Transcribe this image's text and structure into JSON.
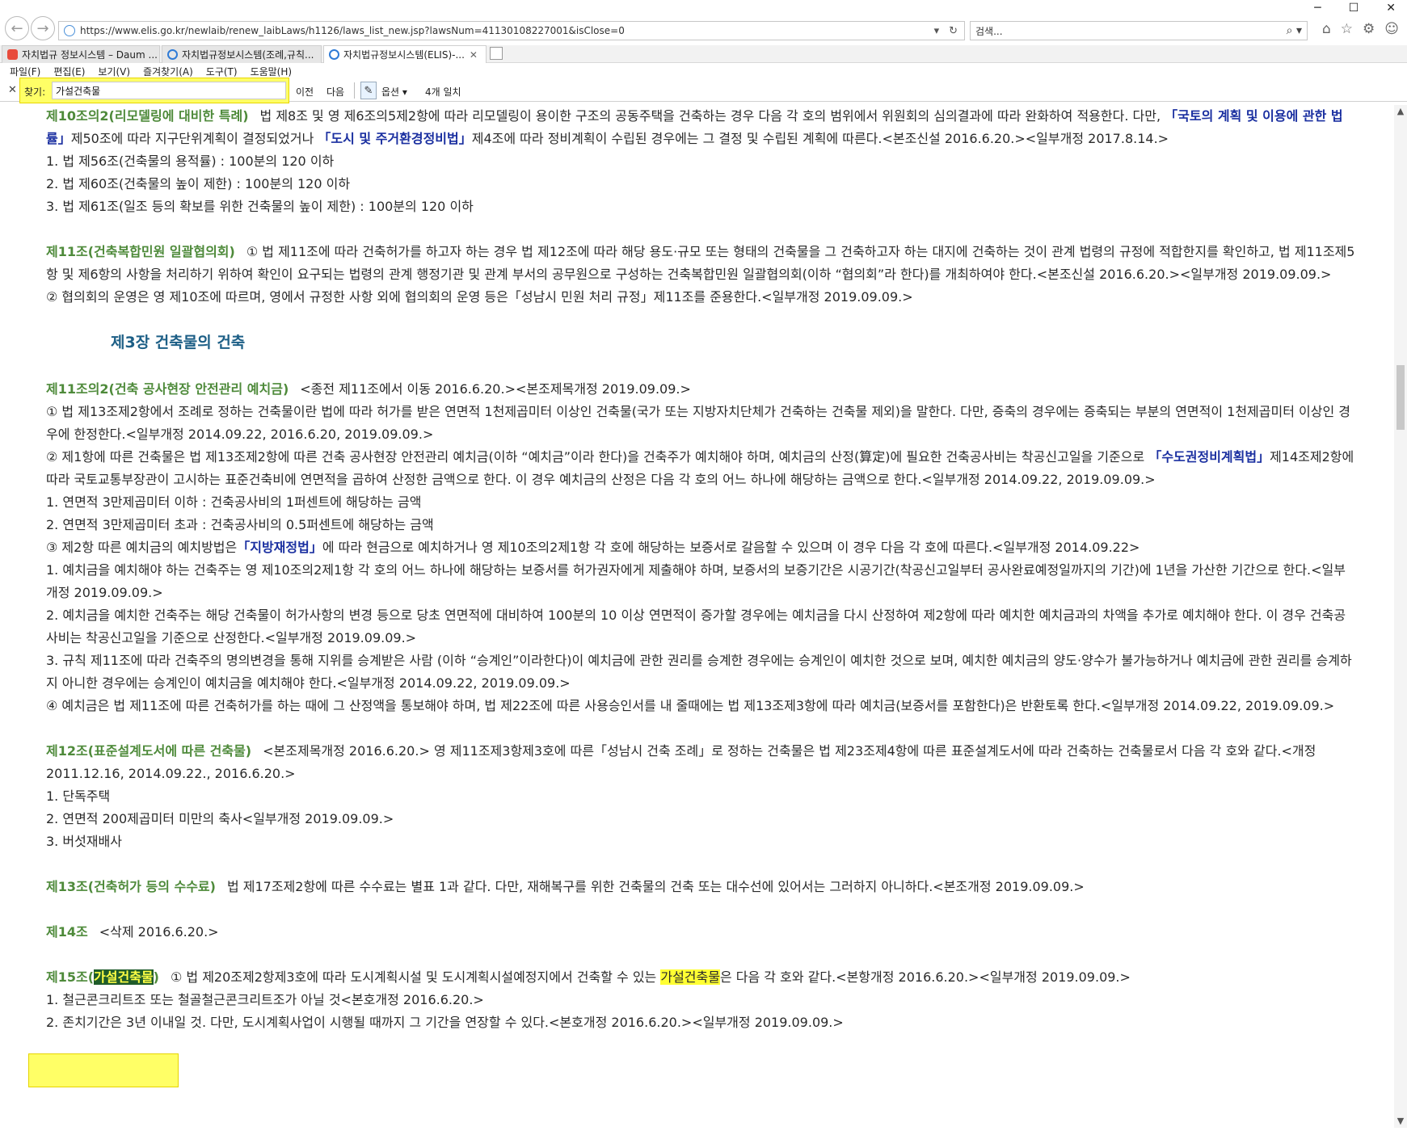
{
  "window": {
    "minimize": "─",
    "maximize": "☐",
    "close": "✕"
  },
  "address_bar": {
    "url": "https://www.elis.go.kr/newlaib/renew_laibLaws/h1126/laws_list_new.jsp?lawsNum=41130108227001&isClose=0"
  },
  "search": {
    "placeholder": "검색..."
  },
  "tabs": [
    {
      "label": "자치법규 정보시스템 – Daum ...",
      "icon_color": "#e84b3c"
    },
    {
      "label": "자치법규정보시스템(조례,규칙...",
      "icon_color": "#2f7bd6"
    },
    {
      "label": "자치법규정보시스템(ELIS)-...",
      "icon_color": "#2f7bd6"
    }
  ],
  "menu": [
    "파일(F)",
    "편집(E)",
    "보기(V)",
    "즐겨찾기(A)",
    "도구(T)",
    "도움말(H)"
  ],
  "find": {
    "label": "찾기:",
    "value": "가설건축물",
    "prev": "이전",
    "next": "다음",
    "options": "옵션",
    "count": "4개 일치"
  },
  "page": {
    "art10_2": {
      "head": "제10조의2(리모델링에 대비한 특례)",
      "t1": "법 제8조 및 영 제6조의5제2항에 따라 리모델링이 용이한 구조의 공동주택을 건축하는 경우 다음 각 호의 범위에서 위원회의 심의결과에 따라 완화하여 적용한다. 다만, ",
      "l1": "「국토의 계획 및 이용에 관한 법률」",
      "t2": "제50조에 따라 지구단위계획이 결정되었거나 ",
      "l2": "「도시 및 주거환경정비법」",
      "t3": "제4조에 따라 정비계획이 수립된 경우에는 그 결정 및 수립된 계획에 따른다.<본조신설 2016.6.20.><일부개정 2017.8.14.>",
      "items": [
        "1. 법 제56조(건축물의 용적률) : 100분의 120 이하",
        "2. 법 제60조(건축물의 높이 제한) : 100분의 120 이하",
        "3. 법 제61조(일조 등의 확보를 위한 건축물의 높이 제한) : 100분의 120 이하"
      ]
    },
    "art11": {
      "head": "제11조(건축복합민원 일괄협의회)",
      "p1": "① 법 제11조에 따라 건축허가를 하고자 하는 경우 법 제12조에 따라 해당 용도·규모 또는 형태의 건축물을 그 건축하고자 하는 대지에 건축하는 것이 관계 법령의 규정에 적합한지를 확인하고, 법 제11조제5항 및 제6항의 사항을 처리하기 위하여 확인이 요구되는 법령의 관계 행정기관 및 관계 부서의 공무원으로 구성하는 건축복합민원 일괄협의회(이하 “협의회”라 한다)를 개최하여야 한다.<본조신설 2016.6.20.><일부개정 2019.09.09.>",
      "p2": "② 협의회의 운영은 영 제10조에 따르며, 영에서 규정한 사항 외에 협의회의 운영 등은「성남시 민원 처리 규정」제11조를 준용한다.<일부개정 2019.09.09.>"
    },
    "chapter3": "제3장 건축물의 건축",
    "art11_2": {
      "head": "제11조의2(건축 공사현장 안전관리 예치금)",
      "head_note": "<종전 제11조에서 이동 2016.6.20.><본조제목개정 2019.09.09.>",
      "p1": "① 법 제13조제2항에서 조례로 정하는 건축물이란 법에 따라 허가를 받은 연면적 1천제곱미터 이상인 건축물(국가 또는 지방자치단체가 건축하는 건축물 제외)을 말한다. 다만, 증축의 경우에는 증축되는 부분의 연면적이 1천제곱미터 이상인 경우에 한정한다.<일부개정 2014.09.22, 2016.6.20, 2019.09.09.>",
      "p2a": "② 제1항에 따른 건축물은 법 제13조제2항에 따른 건축 공사현장 안전관리 예치금(이하 “예치금”이라 한다)을 건축주가 예치해야 하며, 예치금의 산정(算定)에 필요한 건축공사비는 착공신고일을 기준으로 ",
      "p2l": "「수도권정비계획법」",
      "p2b": "제14조제2항에 따라 국토교통부장관이 고시하는 표준건축비에 연면적을 곱하여 산정한 금액으로 한다. 이 경우 예치금의 산정은 다음 각 호의 어느 하나에 해당하는 금액으로 한다.<일부개정 2014.09.22, 2019.09.09.>",
      "i1": "1. 연면적 3만제곱미터 이하 : 건축공사비의 1퍼센트에 해당하는 금액",
      "i2": "2. 연면적 3만제곱미터 초과 : 건축공사비의 0.5퍼센트에 해당하는 금액",
      "p3a": "③ 제2항 따른 예치금의 예치방법은",
      "p3l": "「지방재정법」",
      "p3b": "에 따라 현금으로 예치하거나 영 제10조의2제1항 각 호에 해당하는 보증서로 갈음할 수 있으며 이 경우 다음 각 호에 따른다.<일부개정 2014.09.22>",
      "j1": "1. 예치금을 예치해야 하는 건축주는 영 제10조의2제1항 각 호의 어느 하나에 해당하는 보증서를 허가권자에게 제출해야 하며, 보증서의 보증기간은 시공기간(착공신고일부터 공사완료예정일까지의 기간)에 1년을 가산한 기간으로 한다.<일부개정 2019.09.09.>",
      "j2": "2. 예치금을 예치한 건축주는 해당 건축물이 허가사항의 변경 등으로 당초 연면적에 대비하여 100분의 10 이상 연면적이 증가할 경우에는 예치금을 다시 산정하여 제2항에 따라 예치한 예치금과의 차액을 추가로 예치해야 한다. 이 경우 건축공사비는 착공신고일을 기준으로 산정한다.<일부개정 2019.09.09.>",
      "j3": "3. 규칙 제11조에 따라 건축주의 명의변경을 통해 지위를 승계받은 사람 (이하 “승계인”이라한다)이 예치금에 관한 권리를 승계한 경우에는 승계인이 예치한 것으로 보며, 예치한 예치금의 양도·양수가 불가능하거나 예치금에 관한 권리를 승계하지 아니한 경우에는 승계인이 예치금을 예치해야 한다.<일부개정 2014.09.22, 2019.09.09.>",
      "p4": "④ 예치금은 법 제11조에 따른 건축허가를 하는 때에 그 산정액을 통보해야 하며, 법 제22조에 따른 사용승인서를 내 줄때에는 법 제13조제3항에 따라 예치금(보증서를 포함한다)은 반환토록 한다.<일부개정 2014.09.22, 2019.09.09.>"
    },
    "art12": {
      "head": "제12조(표준설계도서에 따른 건축물)",
      "body": "<본조제목개정 2016.6.20.> 영 제11조제3항제3호에 따른「성남시 건축 조례」로 정하는 건축물은 법 제23조제4항에 따른 표준설계도서에 따라 건축하는 건축물로서 다음 각 호와 같다.<개정 2011.12.16, 2014.09.22., 2016.6.20.>",
      "items": [
        "1. 단독주택",
        "2. 연면적 200제곱미터 미만의 축사<일부개정 2019.09.09.>",
        "3. 버섯재배사"
      ]
    },
    "art13": {
      "head": "제13조(건축허가 등의 수수료)",
      "body": "법 제17조제2항에 따른 수수료는 별표 1과 같다. 다만, 재해복구를 위한 건축물의 건축 또는 대수선에 있어서는 그러하지 아니하다.<본조개정 2019.09.09.>"
    },
    "art14": {
      "head": "제14조",
      "body": "<삭제 2016.6.20.>"
    },
    "art15": {
      "head_pre": "제15조(",
      "head_hl": "가설건축물",
      "head_post": ")",
      "p1a": "① 법 제20조제2항제3호에 따라 도시계획시설 및 도시계획시설예정지에서 건축할 수 있는 ",
      "p1hl": "가설건축물",
      "p1b": "은 다음 각 호와 같다.<본항개정 2016.6.20.><일부개정 2019.09.09.>",
      "i1": "1. 철근콘크리트조 또는 철골철근콘크리트조가 아닐 것<본호개정 2016.6.20.>",
      "i2": "2. 존치기간은 3년 이내일 것. 다만, 도시계획사업이 시행될 때까지 그 기간을 연장할 수 있다.<본호개정 2016.6.20.><일부개정 2019.09.09.>"
    }
  }
}
